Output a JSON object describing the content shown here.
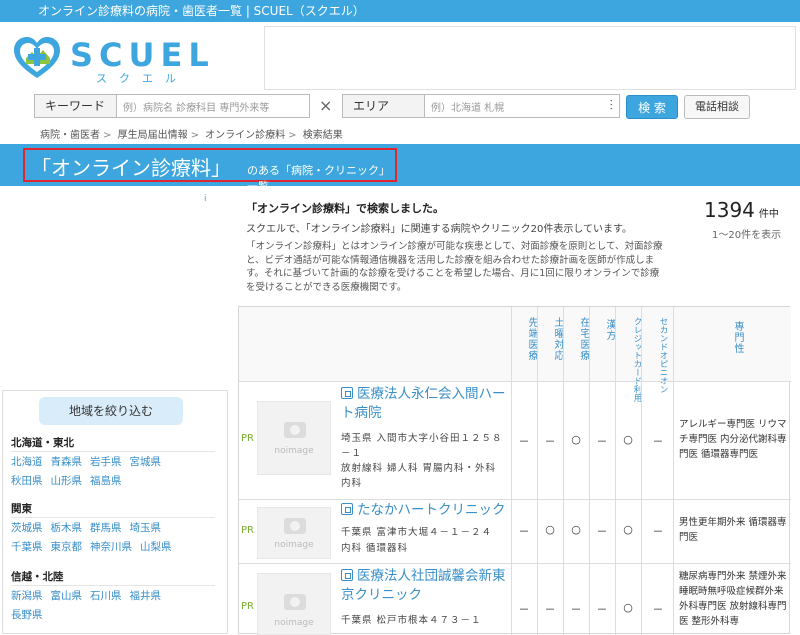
{
  "topbar": {
    "title": "オンライン診療料の病院・歯医者一覧 | SCUEL（スクエル）"
  },
  "logo": {
    "word": "SCUEL",
    "kana": "スクエル"
  },
  "search": {
    "keyword_label": "キーワード",
    "keyword_placeholder": "例）病院名 診療科目 専門外来等",
    "clear": "×",
    "area_label": "エリア",
    "area_placeholder": "例）北海道 札幌",
    "search_button": "検 索",
    "phone_button": "電話相談"
  },
  "breadcrumb": [
    "病院・歯医者",
    "厚生局届出情報",
    "オンライン診療料",
    "検索結果"
  ],
  "banner": {
    "title": "「オンライン診療料」",
    "suffix": "のある「病院・クリニック」一覧"
  },
  "ad_info": "i",
  "result": {
    "heading": "「オンライン診療料」で検索しました。",
    "sub": "スクエルで、「オンライン診療料」に関連する病院やクリニック20件表示しています。",
    "count": "1394",
    "count_unit": "件中",
    "range": "1〜20件を表示",
    "description": "「オンライン診療料」とはオンライン診療が可能な疾患として、対面診療を原則として、対面診療と、ビデオ通話が可能な情報通信機器を活用した診療を組み合わせた診療計画を医師が作成します。それに基づいて計画的な診療を受けることを希望した場合、月に1回に限りオンラインで診療を受けることができる医療機関です。"
  },
  "filter": {
    "title": "地域を絞り込む",
    "regions": [
      {
        "name": "北海道・東北",
        "prefs": [
          "北海道",
          "青森県",
          "岩手県",
          "宮城県",
          "秋田県",
          "山形県",
          "福島県"
        ]
      },
      {
        "name": "関東",
        "prefs": [
          "茨城県",
          "栃木県",
          "群馬県",
          "埼玉県",
          "千葉県",
          "東京都",
          "神奈川県",
          "山梨県"
        ]
      },
      {
        "name": "信越・北陸",
        "prefs": [
          "新潟県",
          "富山県",
          "石川県",
          "福井県",
          "長野県"
        ]
      }
    ]
  },
  "table": {
    "columns": [
      "先端医療",
      "土曜対応",
      "在宅医療",
      "漢方",
      "クレジットカード利用",
      "セカンドオピニオン",
      "専門性"
    ],
    "noimage": "noimage",
    "pr": "PR",
    "rows": [
      {
        "name": "医療法人永仁会入間ハート病院",
        "address": "埼玉県 入間市大字小谷田１２５８－１",
        "depts": "放射線科 婦人科 胃腸内科・外科 内科",
        "cells": [
          "－",
          "－",
          "○",
          "－",
          "○",
          "－"
        ],
        "specialty": "アレルギー専門医 リウマチ専門医 内分泌代謝科専門医 循環器専門医"
      },
      {
        "name": "たなかハートクリニック",
        "address": "千葉県 富津市大堀４－１－２４",
        "depts": "内科 循環器科",
        "cells": [
          "－",
          "○",
          "○",
          "－",
          "○",
          "－"
        ],
        "specialty": "男性更年期外来 循環器専門医"
      },
      {
        "name": "医療法人社団誠馨会新東京クリニック",
        "address": "千葉県 松戸市根本４７３－１",
        "depts": "",
        "cells": [
          "－",
          "－",
          "－",
          "－",
          "○",
          "－"
        ],
        "specialty": "糖尿病専門外来 禁煙外来 睡眠時無呼吸症候群外来 外科専門医 放射線科専門医 整形外科専"
      }
    ]
  },
  "colors": {
    "accent": "#3ea6de",
    "highlight": "#e0262f",
    "pr": "#7ab032"
  }
}
